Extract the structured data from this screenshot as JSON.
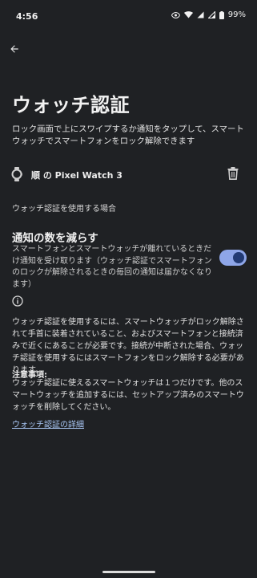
{
  "status_bar": {
    "time": "4:56",
    "battery": "99%",
    "icons": [
      "eye-icon",
      "wifi-icon",
      "signal-icon",
      "signal-icon",
      "battery-icon"
    ]
  },
  "header": {
    "title": "ウォッチ認証"
  },
  "description": "ロック画面で上にスワイプするか通知をタップして、スマートウォッチでスマートフォンをロック解除できます",
  "watch": {
    "name": "順 の Pixel Watch 3",
    "icon": "watch-icon",
    "delete_icon": "trash-icon"
  },
  "section_label": "ウォッチ認証を使用する場合",
  "notification_pref": {
    "title": "通知の数を減らす",
    "summary": "スマートフォンとスマートウォッチが離れているときだけ通知を受け取ります（ウォッチ認証でスマートフォンのロックが解除されるときの毎回の通知は届かなくなります）",
    "enabled": true
  },
  "info": {
    "icon": "info-icon",
    "body": "ウォッチ認証を使用するには、スマートウォッチがロック解除されて手首に装着されていること、およびスマートフォンと接続済みで近くにあることが必要です。接続が中断された場合、ウォッチ認証を使用するにはスマートフォンをロック解除する必要があります。",
    "note_title": "注意事項:",
    "note_body": "ウォッチ認証に使えるスマートウォッチは１つだけです。他のスマートウォッチを追加するには、セットアップ済みのスマートウォッチを削除してください。",
    "link": "ウォッチ認証の詳細"
  },
  "colors": {
    "background": "#1f2124",
    "toggle_track": "#8ea6e8",
    "toggle_thumb": "#223a73",
    "link": "#a9c7f5"
  }
}
